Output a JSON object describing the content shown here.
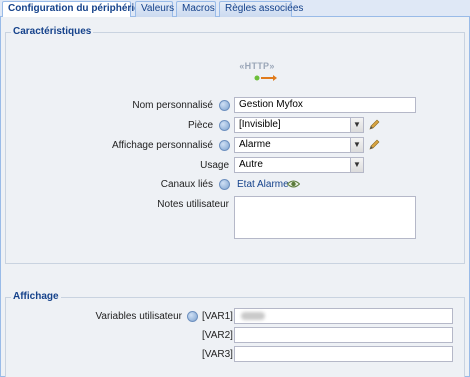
{
  "tabs": [
    {
      "label": "Configuration du périphérique"
    },
    {
      "label": "Valeurs"
    },
    {
      "label": "Macros"
    },
    {
      "label": "Règles associées"
    }
  ],
  "characteristics": {
    "legend": "Caractéristiques",
    "device_icon_text": "«HTTP»",
    "fields": {
      "name_label": "Nom personnalisé",
      "name_value": "Gestion Myfox",
      "room_label": "Pièce",
      "room_value": "[Invisible]",
      "display_label": "Affichage personnalisé",
      "display_value": "Alarme",
      "usage_label": "Usage",
      "usage_value": "Autre",
      "channels_label": "Canaux liés",
      "channels_link": "Etat Alarme",
      "notes_label": "Notes utilisateur"
    }
  },
  "display_section": {
    "legend": "Affichage",
    "variables_label": "Variables utilisateur",
    "vars": [
      {
        "tag": "[VAR1]"
      },
      {
        "tag": "[VAR2]"
      },
      {
        "tag": "[VAR3]"
      }
    ]
  },
  "colors": {
    "accent": "#15428b",
    "tab_border": "#99bbe8",
    "panel_bg": "#eef1f5"
  }
}
